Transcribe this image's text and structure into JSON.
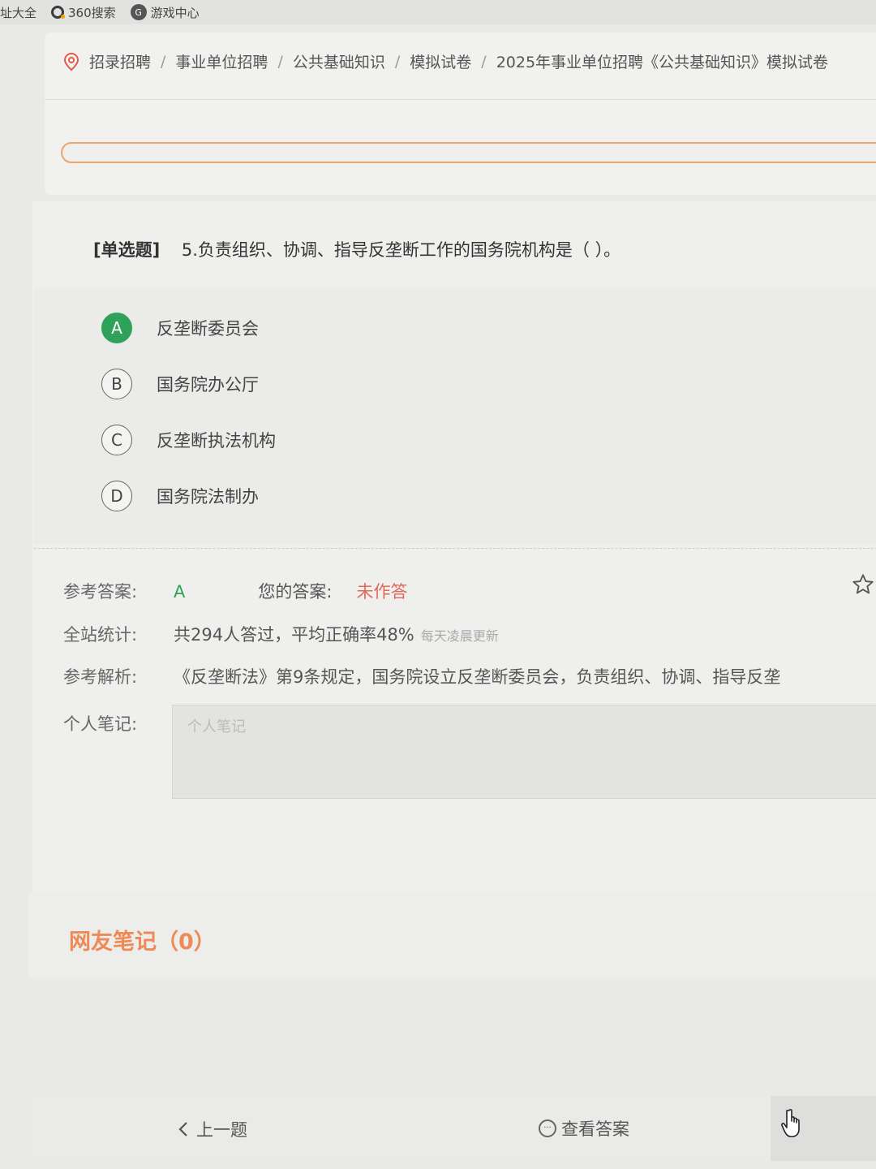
{
  "bookmarks": [
    {
      "label": "址大全"
    },
    {
      "label": "360搜索",
      "icon": "search-360-icon"
    },
    {
      "label": "游戏中心",
      "icon": "game-center-icon"
    }
  ],
  "breadcrumb": {
    "items": [
      "招录招聘",
      "事业单位招聘",
      "公共基础知识",
      "模拟试卷",
      "2025年事业单位招聘《公共基础知识》模拟试卷"
    ],
    "separator": "/"
  },
  "question": {
    "type": "[单选题]",
    "text": "5.负责组织、协调、指导反垄断工作的国务院机构是（   ）。",
    "options": [
      {
        "letter": "A",
        "text": "反垄断委员会",
        "correct": true
      },
      {
        "letter": "B",
        "text": "国务院办公厅",
        "correct": false
      },
      {
        "letter": "C",
        "text": "反垄断执法机构",
        "correct": false
      },
      {
        "letter": "D",
        "text": "国务院法制办",
        "correct": false
      }
    ]
  },
  "answer": {
    "ref_label": "参考答案:",
    "ref_value": "A",
    "your_label": "您的答案:",
    "your_value": "未作答"
  },
  "stats": {
    "label": "全站统计:",
    "value": "共294人答过，平均正确率48%",
    "note": "每天凌晨更新"
  },
  "analysis": {
    "label": "参考解析:",
    "value": "《反垄断法》第9条规定，国务院设立反垄断委员会，负责组织、协调、指导反垄"
  },
  "notes": {
    "label": "个人笔记:",
    "placeholder": "个人笔记"
  },
  "comments": {
    "title": "网友笔记（0）"
  },
  "bottom": {
    "prev_label": "上一题",
    "view_answer_label": "查看答案"
  },
  "colors": {
    "correct_green": "#2fa25a",
    "unanswered_red": "#e06a5a",
    "accent_orange": "#ee8a55"
  }
}
